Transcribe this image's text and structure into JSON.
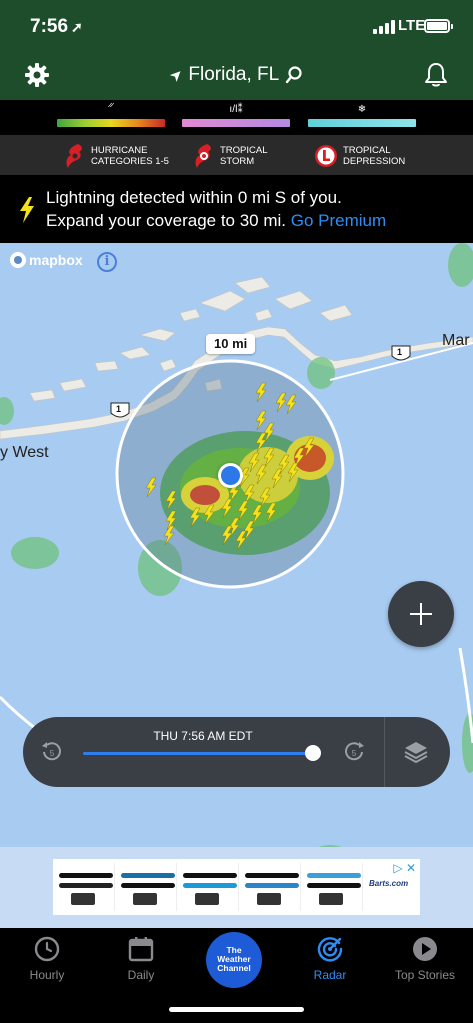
{
  "status": {
    "time": "7:56",
    "network": "LTE"
  },
  "nav": {
    "location": "Florida, FL"
  },
  "legend": {
    "bars": [
      {
        "icon": "rain-icon",
        "gradient": [
          "#3fa63f",
          "#e6d91e",
          "#e8871e",
          "#c62a2a"
        ]
      },
      {
        "icon": "mix-icon",
        "gradient": [
          "#e28ad1",
          "#b38ae2"
        ]
      },
      {
        "icon": "snow-icon",
        "gradient": [
          "#5fd0d9",
          "#8fe3eb"
        ]
      }
    ],
    "keys": [
      {
        "label_1": "HURRICANE",
        "label_2": "CATEGORIES 1-5",
        "color": "#d81f26"
      },
      {
        "label_1": "TROPICAL",
        "label_2": "STORM",
        "color": "#d81f26"
      },
      {
        "label_1": "TROPICAL",
        "label_2": "DEPRESSION",
        "color": "#d81f26"
      }
    ]
  },
  "alert": {
    "line1": "Lightning detected within 0 mi S of you.",
    "line2": "Expand your coverage to 30 mi.",
    "link": "Go Premium"
  },
  "map": {
    "attribution": "mapbox",
    "info_symbol": "i",
    "labels": {
      "key_west": "y West",
      "marathon": "Mar",
      "route_a": "1",
      "route_b": "1"
    },
    "radius_label": "10 mi"
  },
  "timeline": {
    "time": "THU 7:56 AM EDT",
    "position": 0.96
  },
  "ad": {
    "brand": "Barts.com",
    "close": "▷ ✕"
  },
  "tabs": [
    {
      "label": "Hourly",
      "icon": "clock-icon"
    },
    {
      "label": "Daily",
      "icon": "calendar-icon"
    },
    {
      "label": "The Weather Channel",
      "icon": "twc-logo"
    },
    {
      "label": "Radar",
      "icon": "radar-icon",
      "active": true
    },
    {
      "label": "Top Stories",
      "icon": "play-icon"
    }
  ],
  "colors": {
    "header": "#1d4d2b",
    "accent": "#2e8df5",
    "water": "#a8cbf1",
    "land": "#e8e6df"
  }
}
